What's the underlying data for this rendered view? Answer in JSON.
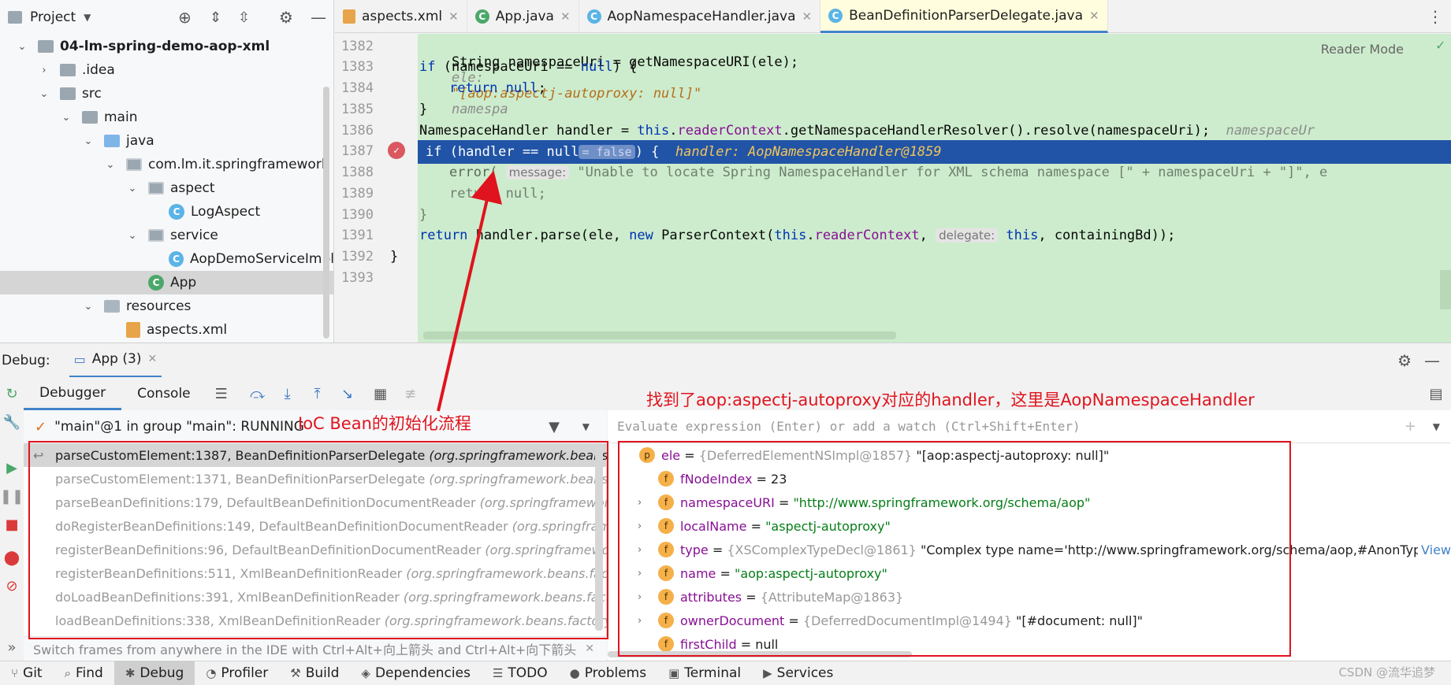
{
  "project": {
    "header_label": "Project",
    "tree": [
      {
        "label": "04-lm-spring-demo-aop-xml",
        "chev": "⌄"
      },
      {
        "label": ".idea",
        "chev": "›"
      },
      {
        "label": "src",
        "chev": "⌄"
      },
      {
        "label": "main",
        "chev": "⌄"
      },
      {
        "label": "java",
        "chev": "⌄"
      },
      {
        "label": "com.lm.it.springframework",
        "chev": "⌄"
      },
      {
        "label": "aspect",
        "chev": "⌄"
      },
      {
        "label": "LogAspect",
        "chev": ""
      },
      {
        "label": "service",
        "chev": "⌄"
      },
      {
        "label": "AopDemoServiceImpl",
        "chev": ""
      },
      {
        "label": "App",
        "chev": ""
      },
      {
        "label": "resources",
        "chev": "⌄"
      },
      {
        "label": "aspects.xml",
        "chev": ""
      }
    ]
  },
  "editor": {
    "tabs": [
      {
        "label": "aspects.xml"
      },
      {
        "label": "App.java"
      },
      {
        "label": "AopNamespaceHandler.java"
      },
      {
        "label": "BeanDefinitionParserDelegate.java"
      }
    ],
    "reader_mode": "Reader Mode",
    "line_numbers": [
      "1382",
      "1383",
      "1384",
      "1385",
      "1386",
      "1387",
      "1388",
      "1389",
      "1390",
      "1391",
      "1392",
      "1393"
    ],
    "lines": {
      "l1382_code": "String namespaceUri = getNamespaceURI(ele);",
      "l1382_hint_name": "ele:",
      "l1382_hint_val": "\"[aop:aspectj-autoproxy: null]\"",
      "l1382_hint_more": "namespa",
      "l1383_kw": "if",
      "l1383_rest": " (namespaceUri == ",
      "l1383_null": "null",
      "l1383_end": ") {",
      "l1384_kw": "return",
      "l1384_null": " null",
      "l1384_end": ";",
      "l1385": "}",
      "l1386_a": "NamespaceHandler handler = ",
      "l1386_this": "this",
      "l1386_b": ".",
      "l1386_field": "readerContext",
      "l1386_c": ".getNamespaceHandlerResolver().resolve(namespaceUri);",
      "l1386_hint": "namespaceUr",
      "l1387_a": "if (handler == null",
      "l1387_inline": "= false",
      "l1387_b": ") {",
      "l1387_hint": "handler: AopNamespaceHandler@1859",
      "l1388_a": "error(",
      "l1388_param": "message:",
      "l1388_str": "\"Unable to locate Spring NamespaceHandler for XML schema namespace [\" + namespaceUri + \"]\", e",
      "l1389": "return null;",
      "l1390": "}",
      "l1391_kw": "return",
      "l1391_a": " handler.parse(ele, ",
      "l1391_new": "new",
      "l1391_b": " ParserContext(",
      "l1391_this": "this",
      "l1391_c": ".",
      "l1391_field": "readerContext",
      "l1391_d": ", ",
      "l1391_param": "delegate:",
      "l1391_this2": " this",
      "l1391_e": ", containingBd));",
      "l1392": "}"
    }
  },
  "debug": {
    "label": "Debug:",
    "session_tab": "App (3)",
    "tabs": [
      "Debugger",
      "Console"
    ],
    "thread": "\"main\"@1 in group \"main\": RUNNING",
    "frames": [
      {
        "method": "parseCustomElement:1387, BeanDefinitionParserDelegate",
        "pkg": "(org.springframework.beans.facto"
      },
      {
        "method": "parseCustomElement:1371, BeanDefinitionParserDelegate",
        "pkg": "(org.springframework.beans.facto"
      },
      {
        "method": "parseBeanDefinitions:179, DefaultBeanDefinitionDocumentReader",
        "pkg": "(org.springframework.be"
      },
      {
        "method": "doRegisterBeanDefinitions:149, DefaultBeanDefinitionDocumentReader",
        "pkg": "(org.springframewo"
      },
      {
        "method": "registerBeanDefinitions:96, DefaultBeanDefinitionDocumentReader",
        "pkg": "(org.springframework.b"
      },
      {
        "method": "registerBeanDefinitions:511, XmlBeanDefinitionReader",
        "pkg": "(org.springframework.beans.factory.x"
      },
      {
        "method": "doLoadBeanDefinitions:391, XmlBeanDefinitionReader",
        "pkg": "(org.springframework.beans.factory.x"
      },
      {
        "method": "loadBeanDefinitions:338, XmlBeanDefinitionReader",
        "pkg": "(org.springframework.beans.factory.xml"
      }
    ],
    "frames_hint": "Switch frames from anywhere in the IDE with Ctrl+Alt+向上箭头 and Ctrl+Alt+向下箭头",
    "eval_placeholder": "Evaluate expression (Enter) or add a watch (Ctrl+Shift+Enter)",
    "variables": [
      {
        "chev": "⌄",
        "badge": "p",
        "name": "ele",
        "eq": " = ",
        "ref": "{DeferredElementNSImpl@1857} ",
        "value": "\"[aop:aspectj-autoproxy: null]\"",
        "value_type": "plain"
      },
      {
        "chev": "",
        "badge": "f",
        "name": "fNodeIndex",
        "eq": " = ",
        "ref": "",
        "value": "23",
        "value_type": "plain"
      },
      {
        "chev": "›",
        "badge": "f",
        "name": "namespaceURI",
        "eq": " = ",
        "ref": "",
        "value": "\"http://www.springframework.org/schema/aop\"",
        "value_type": "str"
      },
      {
        "chev": "›",
        "badge": "f",
        "name": "localName",
        "eq": " = ",
        "ref": "",
        "value": "\"aspectj-autoproxy\"",
        "value_type": "str"
      },
      {
        "chev": "›",
        "badge": "f",
        "name": "type",
        "eq": " = ",
        "ref": "{XSComplexTypeDecl@1861} ",
        "value": "\"Complex type name='http://www.springframework.org/schema/aop,#AnonType_as...",
        "value_type": "plain",
        "link": "View"
      },
      {
        "chev": "›",
        "badge": "f",
        "name": "name",
        "eq": " = ",
        "ref": "",
        "value": "\"aop:aspectj-autoproxy\"",
        "value_type": "str"
      },
      {
        "chev": "›",
        "badge": "f",
        "name": "attributes",
        "eq": " = ",
        "ref": "{AttributeMap@1863}",
        "value": "",
        "value_type": "plain"
      },
      {
        "chev": "›",
        "badge": "f",
        "name": "ownerDocument",
        "eq": " = ",
        "ref": "{DeferredDocumentImpl@1494} ",
        "value": "\"[#document: null]\"",
        "value_type": "plain"
      },
      {
        "chev": "",
        "badge": "f",
        "name": "firstChild",
        "eq": " = ",
        "ref": "",
        "value": "null",
        "value_type": "plain"
      }
    ]
  },
  "bottom_bar": [
    {
      "label": "Git",
      "icon": "⑂"
    },
    {
      "label": "Find",
      "icon": "⌕"
    },
    {
      "label": "Debug",
      "icon": "✱"
    },
    {
      "label": "Profiler",
      "icon": "◔"
    },
    {
      "label": "Build",
      "icon": "⚒"
    },
    {
      "label": "Dependencies",
      "icon": "◈"
    },
    {
      "label": "TODO",
      "icon": "☰"
    },
    {
      "label": "Problems",
      "icon": "●"
    },
    {
      "label": "Terminal",
      "icon": "▣"
    },
    {
      "label": "Services",
      "icon": "▶"
    }
  ],
  "annotations": {
    "ioc_label": "IoC Bean的初始化流程",
    "handler_label": "找到了aop:aspectj-autoproxy对应的handler，这里是AopNamespaceHandler"
  },
  "watermark": "CSDN @流华追梦",
  "colors": {
    "exec_line": "#2154a6",
    "editor_bg": "#cdeccd",
    "annotation_red": "#e0141e",
    "accent": "#4083c9"
  }
}
